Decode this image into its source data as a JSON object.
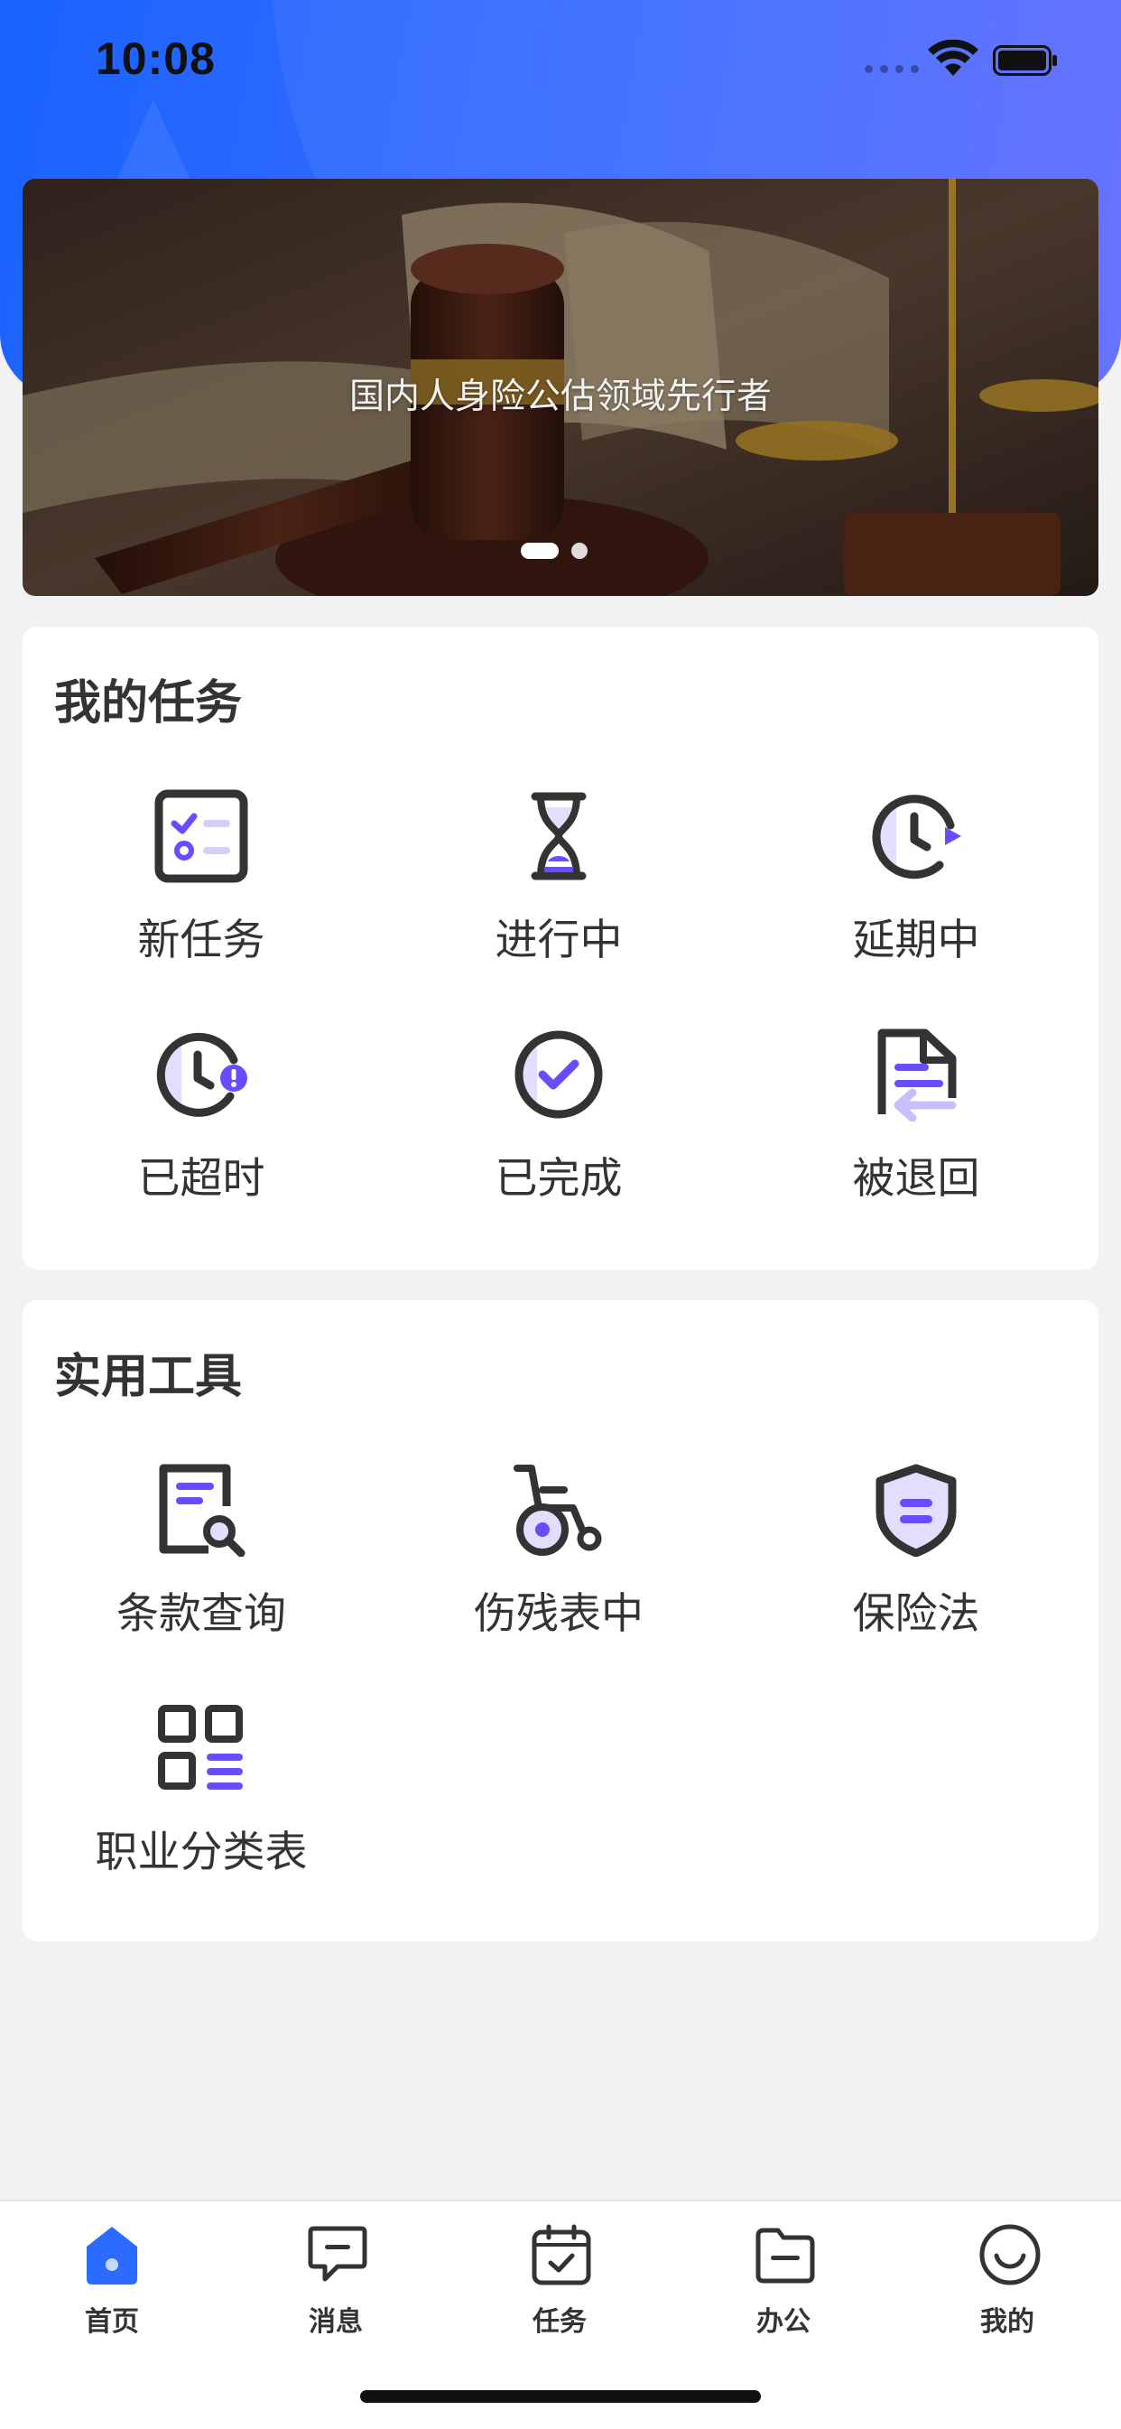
{
  "status_bar": {
    "time": "10:08"
  },
  "banner": {
    "caption": "国内人身险公估领域先行者",
    "dots_count": 2,
    "active_dot": 1
  },
  "my_tasks": {
    "title": "我的任务",
    "items": [
      {
        "label": "新任务",
        "icon": "checklist-icon"
      },
      {
        "label": "进行中",
        "icon": "hourglass-icon"
      },
      {
        "label": "延期中",
        "icon": "clock-play-icon"
      },
      {
        "label": "已超时",
        "icon": "clock-alert-icon"
      },
      {
        "label": "已完成",
        "icon": "check-circle-icon"
      },
      {
        "label": "被退回",
        "icon": "document-return-icon"
      }
    ]
  },
  "tools": {
    "title": "实用工具",
    "items": [
      {
        "label": "条款查询",
        "icon": "document-search-icon"
      },
      {
        "label": "伤残表中",
        "icon": "wheelchair-icon"
      },
      {
        "label": "保险法",
        "icon": "shield-icon"
      },
      {
        "label": "职业分类表",
        "icon": "grid-list-icon"
      }
    ]
  },
  "tabbar": {
    "items": [
      {
        "label": "首页",
        "icon": "home-icon",
        "active": true
      },
      {
        "label": "消息",
        "icon": "message-icon",
        "active": false
      },
      {
        "label": "任务",
        "icon": "calendar-check-icon",
        "active": false
      },
      {
        "label": "办公",
        "icon": "folder-icon",
        "active": false
      },
      {
        "label": "我的",
        "icon": "smile-icon",
        "active": false
      }
    ]
  },
  "colors": {
    "accent": "#6a4cff",
    "brand_blue": "#1a63ff",
    "icon_dark": "#333333",
    "icon_light_fill": "#e4ddff"
  }
}
